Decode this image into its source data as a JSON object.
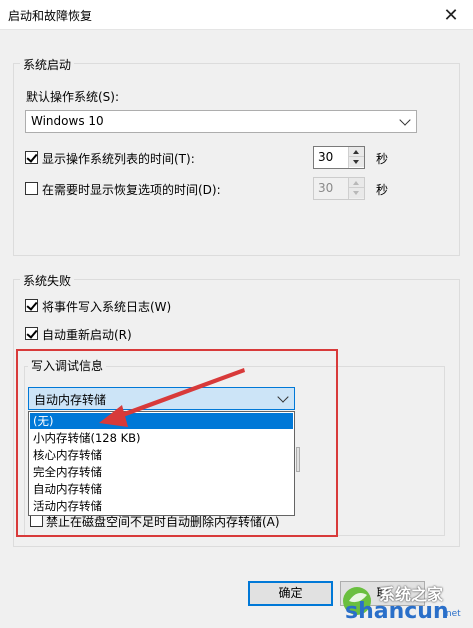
{
  "window": {
    "title": "启动和故障恢复",
    "close_glyph": "✕"
  },
  "system_startup": {
    "legend": "系统启动",
    "default_os_label": "默认操作系统(S):",
    "default_os_value": "Windows 10",
    "show_list": {
      "label": "显示操作系统列表的时间(T):",
      "checked": true,
      "value": "30",
      "unit": "秒"
    },
    "show_recovery": {
      "label": "在需要时显示恢复选项的时间(D):",
      "checked": false,
      "value": "30",
      "unit": "秒"
    }
  },
  "system_failure": {
    "legend": "系统失败",
    "write_event": {
      "label": "将事件写入系统日志(W)",
      "checked": true
    },
    "auto_restart": {
      "label": "自动重新启动(R)",
      "checked": true
    },
    "debug_info": {
      "legend": "写入调试信息",
      "selected": "自动内存转储",
      "options": [
        "(无)",
        "小内存转储(128 KB)",
        "核心内存转储",
        "完全内存转储",
        "自动内存转储",
        "活动内存转储"
      ],
      "highlighted_index": 0
    },
    "disable_auto_delete": {
      "label": "禁止在磁盘空间不足时自动删除内存转储(A)",
      "checked": false
    }
  },
  "buttons": {
    "ok": "确定",
    "cancel": "取"
  },
  "watermark": {
    "text": "shancun",
    "suffix": ".net",
    "brand": "系统之家"
  },
  "colors": {
    "highlight_box": "#d83a3a",
    "selection": "#0078d7",
    "watermark_blue": "#2a6fc9"
  }
}
